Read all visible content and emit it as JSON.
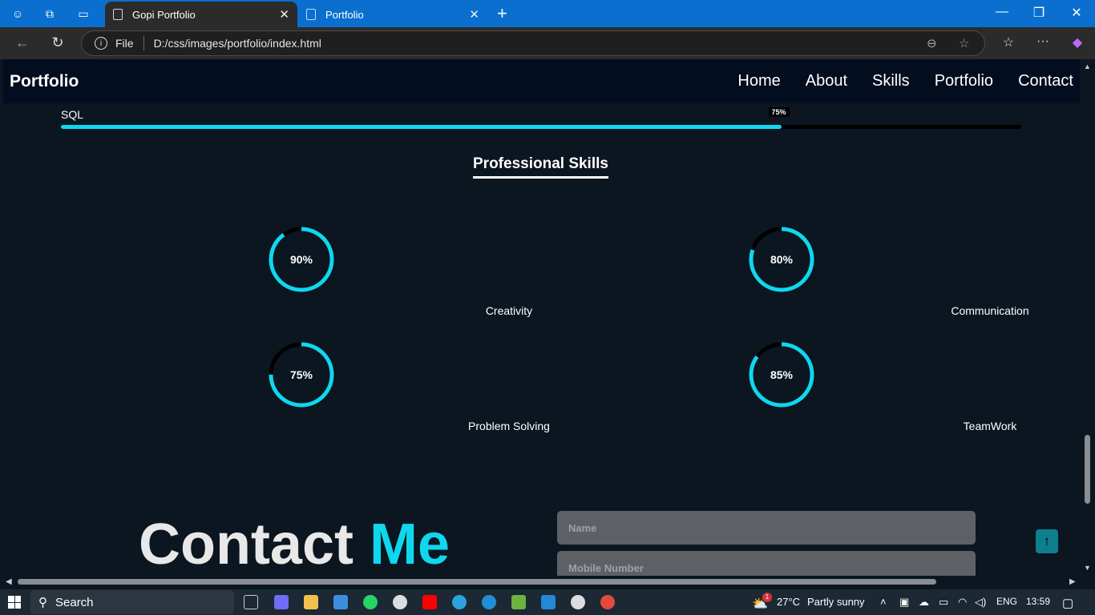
{
  "browser": {
    "tabs": [
      {
        "title": "Gopi Portfolio",
        "active": true
      },
      {
        "title": "Portfolio",
        "active": false
      }
    ],
    "address": {
      "scheme_label": "File",
      "url": "D:/css/images/portfolio/index.html"
    }
  },
  "page": {
    "brand": "Portfolio",
    "nav": [
      "Home",
      "About",
      "Skills",
      "Portfolio",
      "Contact"
    ],
    "sql_skill": {
      "label": "SQL",
      "percent_text": "75%",
      "value": 0.75
    },
    "professional": {
      "title": "Professional Skills",
      "skills": [
        {
          "name": "Creativity",
          "percent_text": "90%",
          "value": 0.9
        },
        {
          "name": "Communication",
          "percent_text": "80%",
          "value": 0.8
        },
        {
          "name": "Problem Solving",
          "percent_text": "75%",
          "value": 0.75
        },
        {
          "name": "TeamWork",
          "percent_text": "85%",
          "value": 0.85
        }
      ]
    },
    "contact": {
      "title_part1": "Contact",
      "title_part2": "Me",
      "name_placeholder": "Name",
      "mobile_placeholder": "Mobile Number"
    },
    "accent_color": "#0fd7ee"
  },
  "taskbar": {
    "search_label": "Search",
    "weather": {
      "temp": "27°C",
      "condition": "Partly sunny",
      "badge": "1"
    },
    "language": "ENG",
    "time": "13:59"
  }
}
